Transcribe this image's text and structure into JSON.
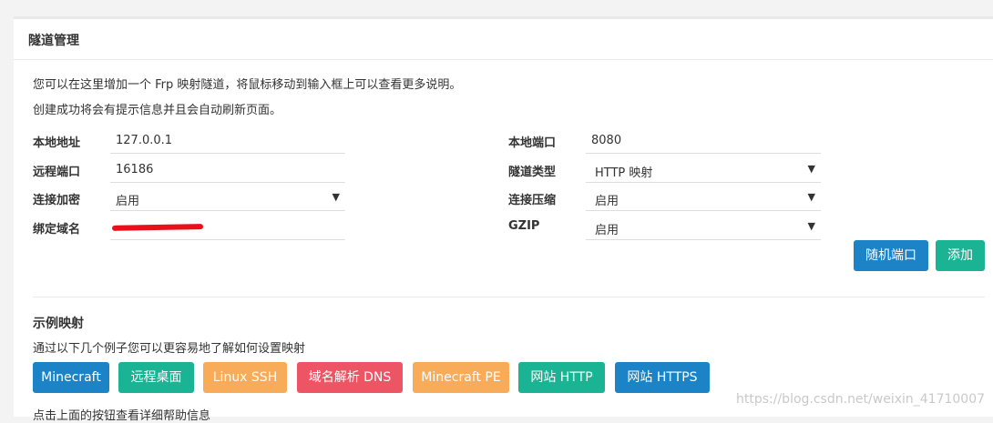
{
  "panel": {
    "title": "隧道管理",
    "desc1": "您可以在这里增加一个 Frp 映射隧道，将鼠标移动到输入框上可以查看更多说明。",
    "desc2": "创建成功将会有提示信息并且会自动刷新页面。"
  },
  "form": {
    "local_addr": {
      "label": "本地地址",
      "value": "127.0.0.1"
    },
    "remote_port": {
      "label": "远程端口",
      "value": "16186"
    },
    "encrypt": {
      "label": "连接加密",
      "value": "启用"
    },
    "domain": {
      "label": "绑定域名",
      "value": ""
    },
    "local_port": {
      "label": "本地端口",
      "value": "8080"
    },
    "tunnel_type": {
      "label": "隧道类型",
      "value": "HTTP 映射"
    },
    "compress": {
      "label": "连接压缩",
      "value": "启用"
    },
    "gzip": {
      "label": "GZIP",
      "value": "启用"
    },
    "arrow": "▼",
    "random_port_label": "随机端口",
    "add_label": "添加"
  },
  "examples": {
    "title": "示例映射",
    "desc": "通过以下几个例子您可以更容易地了解如何设置映射",
    "buttons": [
      "Minecraft",
      "远程桌面",
      "Linux SSH",
      "域名解析 DNS",
      "Minecraft PE",
      "网站 HTTP",
      "网站 HTTPS"
    ],
    "help": "点击上面的按钮查看详细帮助信息"
  },
  "watermark": "https://blog.csdn.net/weixin_41710007",
  "colors": {
    "blue": "#1c84c6",
    "green": "#1ab394",
    "orange": "#f8ac59",
    "red": "#ed5565"
  }
}
